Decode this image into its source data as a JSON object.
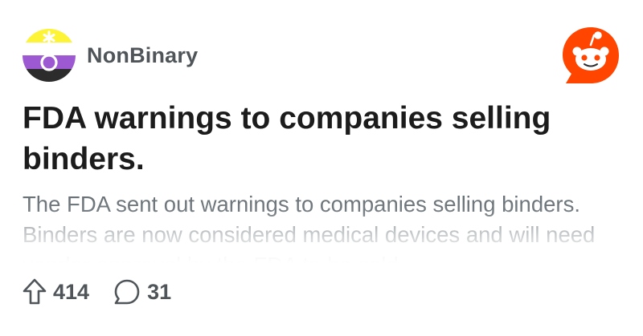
{
  "post": {
    "community": "NonBinary",
    "community_icon": "nonbinary-flag-symbol-icon",
    "brand_icon": "reddit-logo-icon",
    "title": "FDA warnings to companies selling binders.",
    "body": "The FDA sent out warnings to companies selling binders. Binders are now considered medical devices and will need vendor approval by the FDA to be sold.",
    "upvotes": "414",
    "comments": "31"
  },
  "colors": {
    "flag_yellow": "#fcf434",
    "flag_white": "#ffffff",
    "flag_purple": "#9c59d1",
    "flag_black": "#2c2c2c",
    "reddit_orange": "#ff4500",
    "text_primary": "#1c1c1c",
    "text_secondary": "#616a70"
  }
}
